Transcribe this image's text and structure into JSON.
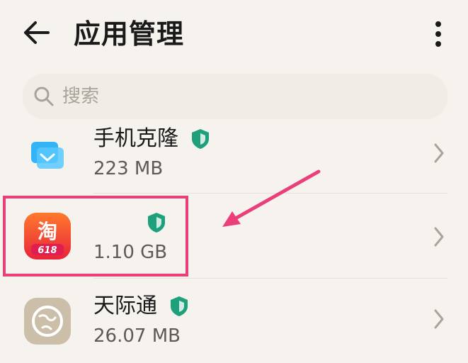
{
  "header": {
    "title": "应用管理",
    "back_icon": "back-arrow-icon",
    "more_icon": "more-vertical-icon"
  },
  "search": {
    "placeholder": "搜索",
    "icon": "search-icon"
  },
  "apps": [
    {
      "name": "手机克隆",
      "size": "223 MB",
      "icon": "phone-clone-icon",
      "verified_icon": "shield-icon"
    },
    {
      "name": "",
      "size": "1.10 GB",
      "icon": "taobao-icon",
      "icon_text": "淘",
      "icon_badge": "618",
      "verified_icon": "shield-icon"
    },
    {
      "name": "天际通",
      "size": "26.07 MB",
      "icon": "globe-icon",
      "verified_icon": "shield-icon"
    }
  ],
  "annotation": {
    "highlight_color": "#ea3f7a",
    "arrow_color": "#ea3f7a"
  },
  "colors": {
    "background": "#f6f3ee",
    "shield": "#1ea07d",
    "taobao": "#f2552b"
  }
}
